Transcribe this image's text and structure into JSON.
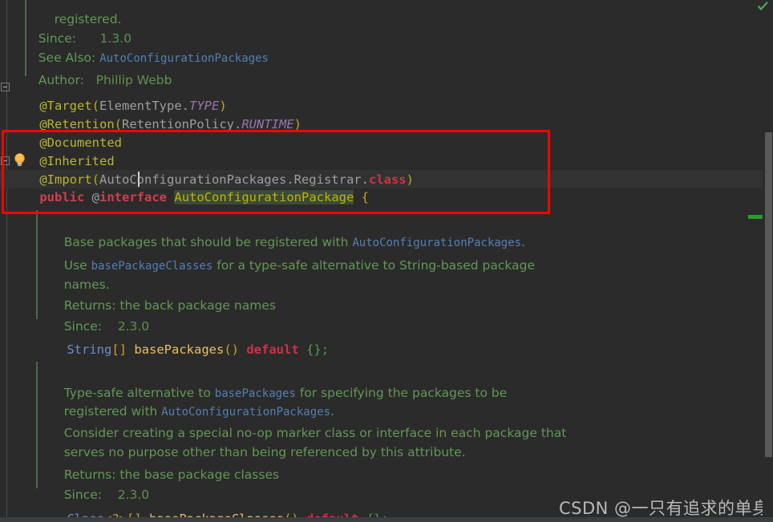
{
  "editor": {
    "background_color": "#2b2b2b",
    "current_line_color": "#323232",
    "doc_comment_color": "#629755",
    "link_color": "#527fb5",
    "annotation_color": "#bbb529",
    "keyword_color": "#cf3f4f",
    "highlight_box_color": "#ff0000",
    "identifier_highlight_color": "#3b4b38"
  },
  "doc_top": {
    "line_registered": "registered.",
    "since_label": "Since:",
    "since_value": "1.3.0",
    "see_also_label": "See Also:",
    "see_also_link": "AutoConfigurationPackages",
    "author_label": "Author:",
    "author_value": "Phillip Webb"
  },
  "annotations": {
    "target": {
      "name": "@Target",
      "open": "(",
      "arg_class": "ElementType",
      "dot": ".",
      "arg_const": "TYPE",
      "close": ")"
    },
    "retention": {
      "name": "@Retention",
      "open": "(",
      "arg_class": "RetentionPolicy",
      "dot": ".",
      "arg_const": "RUNTIME",
      "close": ")"
    },
    "documented": "@Documented",
    "inherited": "@Inherited",
    "import": {
      "name": "@Import",
      "open": "(",
      "arg_path": "AutoConfigurationPackages.Registrar.",
      "arg_keyword": "class",
      "close": ")"
    }
  },
  "declaration": {
    "modifier": "public",
    "at_sign": "@",
    "keyword": "interface",
    "type_name": "AutoConfigurationPackage",
    "brace": "{"
  },
  "member_base_packages": {
    "doc_desc_1a": "Base packages that should be registered with ",
    "doc_desc_1_link": "AutoConfigurationPackages",
    "doc_desc_1b": ".",
    "doc_desc_2a": "Use ",
    "doc_desc_2_link": "basePackageClasses",
    "doc_desc_2b": " for a type-safe alternative to String-based package",
    "doc_desc_2c": "names.",
    "returns": "Returns: the back package names",
    "since_label": "Since:",
    "since_value": "2.3.0",
    "signature": {
      "type": "String",
      "array": "[]",
      "method": "basePackages",
      "parens": "()",
      "default_kw": "default",
      "body": "{}",
      "semicolon": ";"
    }
  },
  "member_base_package_classes": {
    "doc_desc_1a": "Type-safe alternative to ",
    "doc_desc_1_link": "basePackages",
    "doc_desc_1b": " for specifying the packages to be",
    "doc_desc_2a": "registered with ",
    "doc_desc_2_link": "AutoConfigurationPackages",
    "doc_desc_2b": ".",
    "doc_desc_3": "Consider creating a special no-op marker class or interface in each package that",
    "doc_desc_4": "serves no purpose other than being referenced by this attribute.",
    "returns": "Returns: the base package classes",
    "since_label": "Since:",
    "since_value": "2.3.0",
    "signature": {
      "type": "Class",
      "generic": "<?>",
      "array": "[]",
      "method": "basePackageClasses",
      "parens": "()",
      "default_kw": "default",
      "body": "{}",
      "semicolon": ";"
    }
  },
  "icons": {
    "lightbulb": "lightbulb-intention-icon",
    "inspection_status": "inspection-ok-check-icon",
    "fold_expanded": "fold-expanded-icon"
  },
  "watermark": {
    "text": "CSDN @一只有追求的单身狗"
  }
}
